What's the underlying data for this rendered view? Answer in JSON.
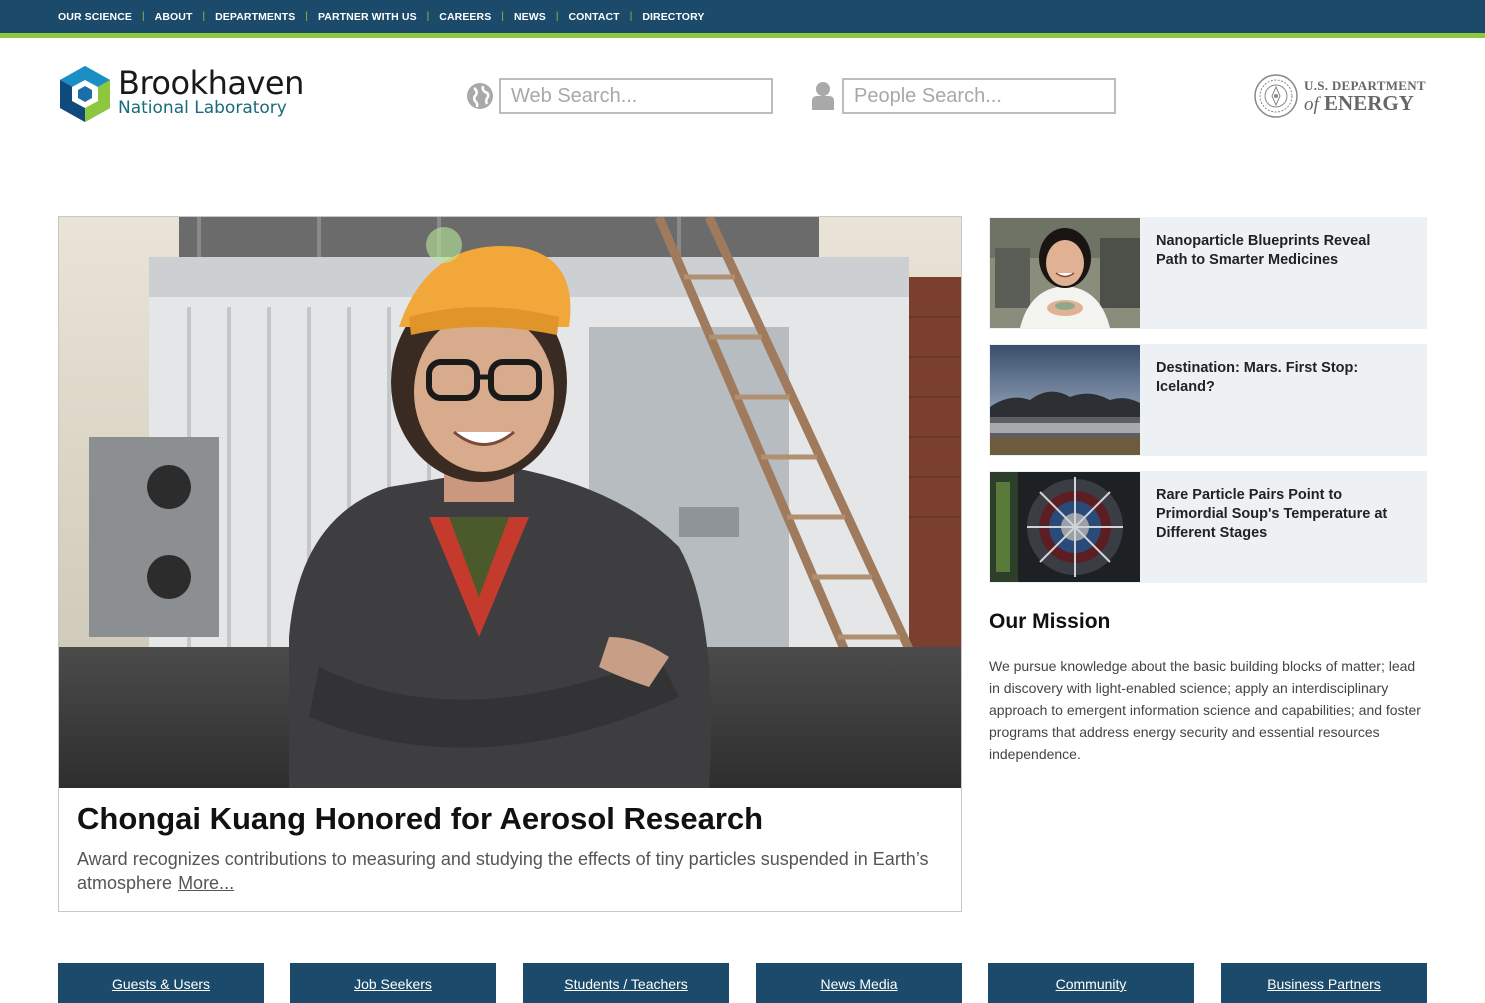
{
  "topnav": {
    "items": [
      {
        "label": "OUR SCIENCE"
      },
      {
        "label": "ABOUT"
      },
      {
        "label": "DEPARTMENTS"
      },
      {
        "label": "PARTNER WITH US"
      },
      {
        "label": "CAREERS"
      },
      {
        "label": "NEWS"
      },
      {
        "label": "CONTACT"
      },
      {
        "label": "DIRECTORY"
      }
    ],
    "separator": "|"
  },
  "header": {
    "logo_line1": "Brookhaven",
    "logo_line2": "National Laboratory",
    "web_search_placeholder": "Web Search...",
    "people_search_placeholder": "People Search...",
    "doe_line1": "U.S. DEPARTMENT",
    "doe_of": "of",
    "doe_line2": "ENERGY"
  },
  "hero": {
    "title": "Chongai Kuang Honored for Aerosol Research",
    "description": "Award recognizes contributions to measuring and studying the effects of tiny particles suspended in Earth’s atmosphere",
    "more_label": "More..."
  },
  "stories": [
    {
      "title": "Nanoparticle Blueprints Reveal Path to Smarter Medicines"
    },
    {
      "title": "Destination: Mars. First Stop: Iceland?"
    },
    {
      "title": "Rare Particle Pairs Point to Primordial Soup's Temperature at Different Stages"
    }
  ],
  "mission": {
    "heading": "Our Mission",
    "text": "We pursue knowledge about the basic building blocks of matter; lead in discovery with light-enabled science; apply an interdisciplinary approach to emergent information science and capabilities; and foster programs that address energy security and essential resources independence."
  },
  "audiences": [
    {
      "label": "Guests & Users"
    },
    {
      "label": "Job Seekers"
    },
    {
      "label": "Students / Teachers"
    },
    {
      "label": "News Media"
    },
    {
      "label": "Community"
    },
    {
      "label": "Business Partners"
    }
  ],
  "colors": {
    "nav_bg": "#1b4a6b",
    "accent_green": "#8dc63f",
    "story_bg": "#eef1f4"
  }
}
